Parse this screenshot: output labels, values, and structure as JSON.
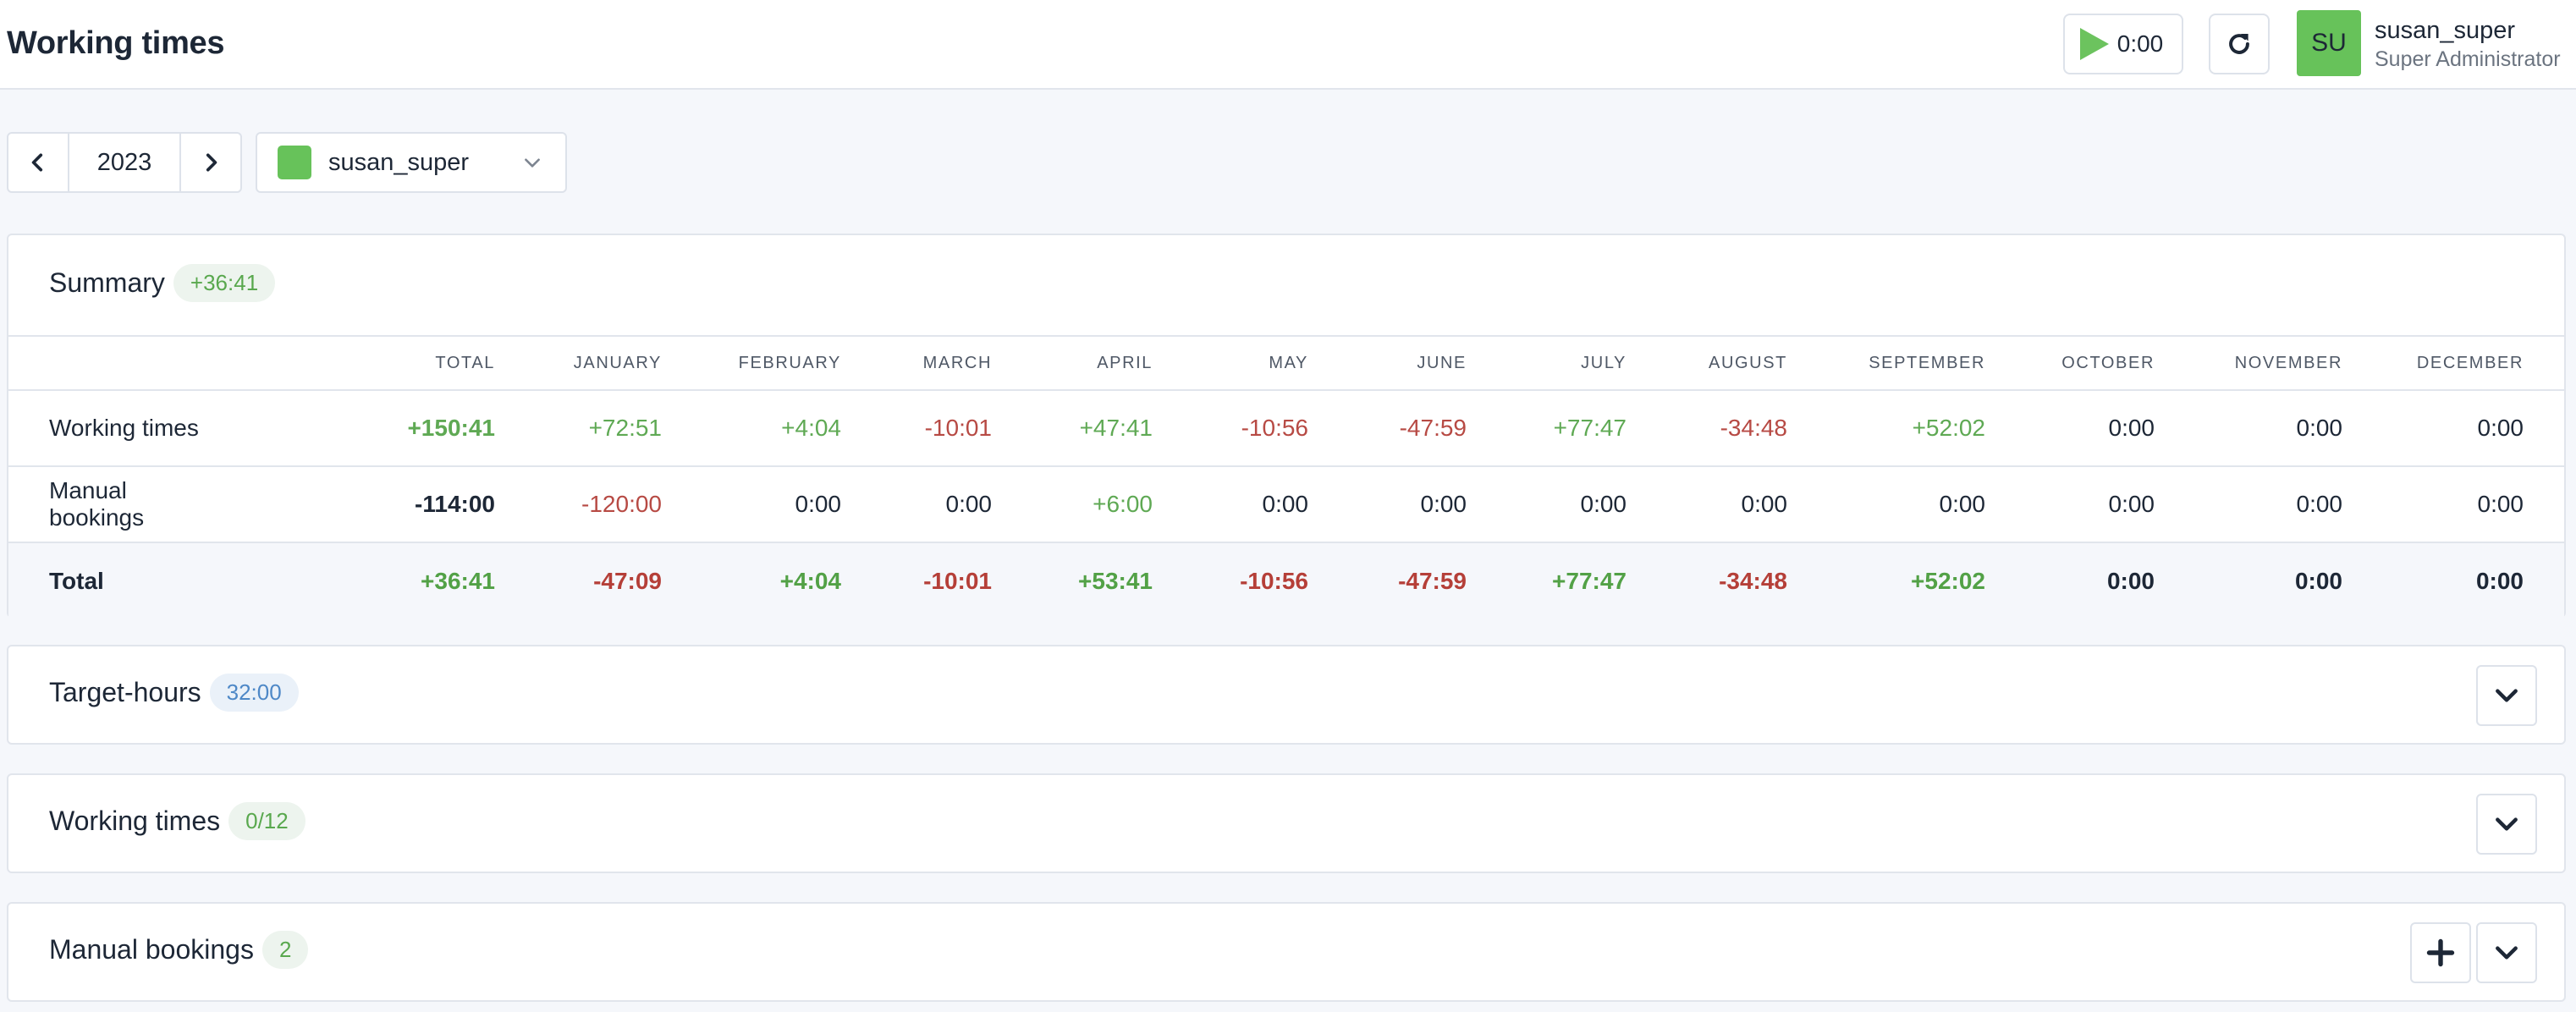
{
  "header": {
    "title": "Working times",
    "timer": "0:00",
    "user": {
      "initials": "SU",
      "name": "susan_super",
      "role": "Super Administrator"
    },
    "colors": {
      "accent": "#67c25a"
    }
  },
  "toolbar": {
    "year": "2023",
    "user_select": "susan_super"
  },
  "summary": {
    "title": "Summary",
    "badge": "+36:41",
    "columns": [
      "",
      "TOTAL",
      "JANUARY",
      "FEBRUARY",
      "MARCH",
      "APRIL",
      "MAY",
      "JUNE",
      "JULY",
      "AUGUST",
      "SEPTEMBER",
      "OCTOBER",
      "NOVEMBER",
      "DECEMBER"
    ],
    "rows": [
      {
        "label": "Working times",
        "total": "+150:41",
        "values": [
          "+72:51",
          "+4:04",
          "-10:01",
          "+47:41",
          "-10:56",
          "-47:59",
          "+77:47",
          "-34:48",
          "+52:02",
          "0:00",
          "0:00",
          "0:00"
        ]
      },
      {
        "label": "Manual bookings",
        "total": "-114:00",
        "values": [
          "-120:00",
          "0:00",
          "0:00",
          "+6:00",
          "0:00",
          "0:00",
          "0:00",
          "0:00",
          "0:00",
          "0:00",
          "0:00",
          "0:00"
        ]
      },
      {
        "label": "Total",
        "total": "+36:41",
        "values": [
          "-47:09",
          "+4:04",
          "-10:01",
          "+53:41",
          "-10:56",
          "-47:59",
          "+77:47",
          "-34:48",
          "+52:02",
          "0:00",
          "0:00",
          "0:00"
        ]
      }
    ]
  },
  "target_hours": {
    "title": "Target-hours",
    "badge": "32:00"
  },
  "working_times": {
    "title": "Working times",
    "badge": "0/12"
  },
  "manual_bookings": {
    "title": "Manual bookings",
    "badge": "2"
  }
}
